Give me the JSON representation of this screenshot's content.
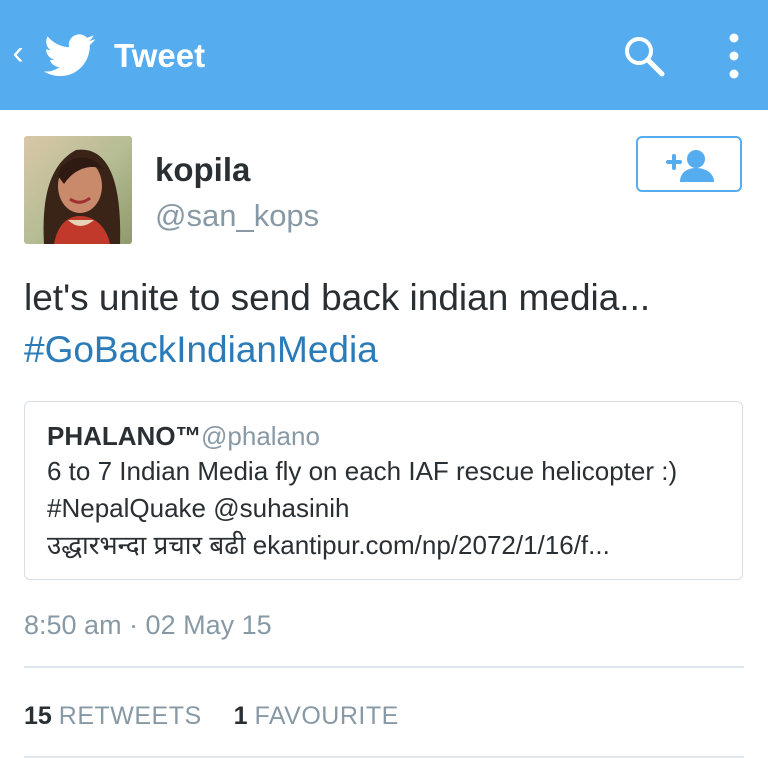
{
  "header": {
    "title": "Tweet",
    "background_color": "#55acee"
  },
  "tweet": {
    "author": {
      "name": "kopila",
      "handle": "@san_kops"
    },
    "text": "let's unite to send back indian media...",
    "hashtag": "#GoBackIndianMedia",
    "timestamp": "8:50 am · 02 May 15"
  },
  "quoted_tweet": {
    "name": "PHALANO™",
    "handle": "@phalano",
    "lines": [
      "6 to 7 Indian Media fly on each IAF rescue helicopter :)",
      "#NepalQuake @suhasinih",
      "उद्धारभन्दा प्रचार बढी ekantipur.com/np/2072/1/16/f..."
    ]
  },
  "stats": {
    "retweets_count": "15",
    "retweets_label": "RETWEETS",
    "favourites_count": "1",
    "favourites_label": "FAVOURITE"
  },
  "icons": {
    "back": "chevron-left-icon",
    "brand": "twitter-bird-icon",
    "search": "search-icon",
    "menu": "overflow-menu-icon",
    "follow": "add-user-icon"
  }
}
